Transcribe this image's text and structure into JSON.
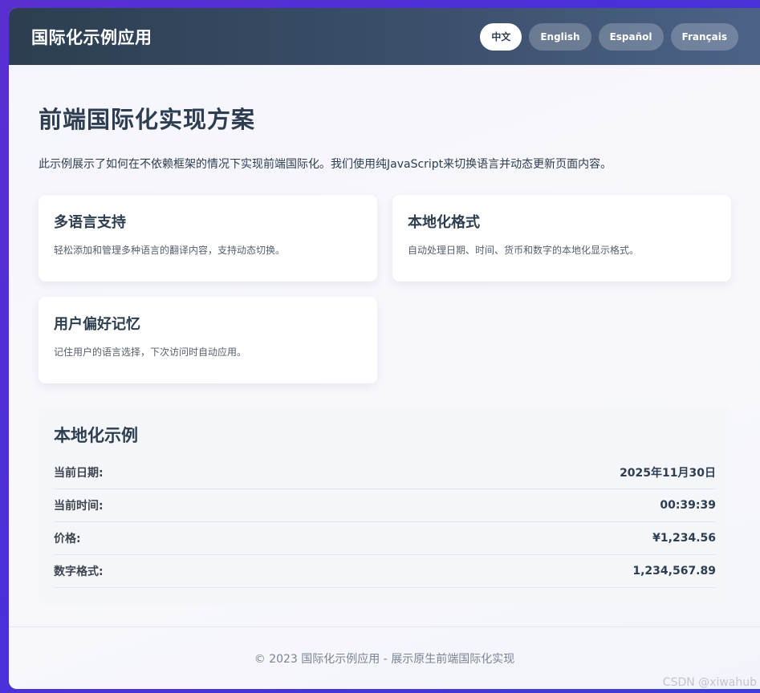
{
  "header": {
    "title": "国际化示例应用",
    "languages": [
      {
        "label": "中文",
        "active": true
      },
      {
        "label": "English",
        "active": false
      },
      {
        "label": "Español",
        "active": false
      },
      {
        "label": "Français",
        "active": false
      }
    ]
  },
  "main": {
    "title": "前端国际化实现方案",
    "intro": "此示例展示了如何在不依赖框架的情况下实现前端国际化。我们使用纯JavaScript来切换语言并动态更新页面内容。",
    "features": [
      {
        "title": "多语言支持",
        "desc": "轻松添加和管理多种语言的翻译内容，支持动态切换。"
      },
      {
        "title": "本地化格式",
        "desc": "自动处理日期、时间、货币和数字的本地化显示格式。"
      },
      {
        "title": "用户偏好记忆",
        "desc": "记住用户的语言选择，下次访问时自动应用。"
      }
    ],
    "examples": {
      "title": "本地化示例",
      "rows": [
        {
          "label": "当前日期:",
          "value": "2025年11月30日"
        },
        {
          "label": "当前时间:",
          "value": "00:39:39"
        },
        {
          "label": "价格:",
          "value": "¥1,234.56"
        },
        {
          "label": "数字格式:",
          "value": "1,234,567.89"
        }
      ]
    }
  },
  "footer": {
    "text": "© 2023 国际化示例应用 - 展示原生前端国际化实现"
  },
  "watermark": "CSDN @xiwahub",
  "colors": {
    "header_dark": "#2c3e50",
    "header_light": "#4c6387",
    "background_purple": "#5a2fd0",
    "text_primary": "#2c3e50"
  }
}
